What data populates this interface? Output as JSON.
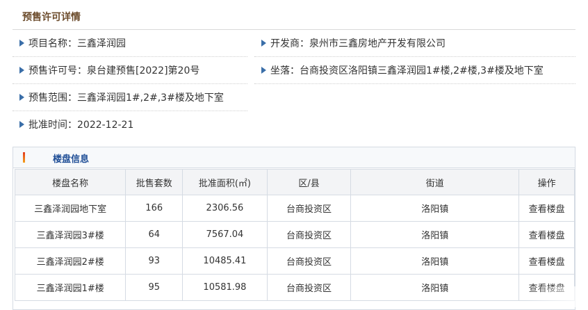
{
  "page": {
    "title": "预售许可详情"
  },
  "info": {
    "project_name": "项目名称：三鑫泽润园",
    "developer": "开发商：泉州市三鑫房地产开发有限公司",
    "license_no": "预售许可号：泉台建预售[2022]第20号",
    "location": "坐落：台商投资区洛阳镇三鑫泽润园1#楼,2#楼,3#楼及地下室",
    "scope": "预售范围：三鑫泽润园1#,2#,3#楼及地下室",
    "approval_date": "批准时间：2022-12-21"
  },
  "buildings": {
    "title": "楼盘信息",
    "columns": [
      "楼盘名称",
      "批售套数",
      "批准面积(㎡)",
      "区/县",
      "街道",
      "操作"
    ],
    "rows": [
      [
        "三鑫泽润园地下室",
        "166",
        "2306.56",
        "台商投资区",
        "洛阳镇",
        "查看楼盘"
      ],
      [
        "三鑫泽润园3#楼",
        "64",
        "7567.04",
        "台商投资区",
        "洛阳镇",
        "查看楼盘"
      ],
      [
        "三鑫泽润园2#楼",
        "93",
        "10485.41",
        "台商投资区",
        "洛阳镇",
        "查看楼盘"
      ],
      [
        "三鑫泽润园1#楼",
        "95",
        "10581.98",
        "台商投资区",
        "洛阳镇",
        "查看楼盘"
      ]
    ]
  },
  "colors": {
    "accent": "#1f4e96",
    "title": "#6b4b2b",
    "bullet": "#3a6ea8"
  }
}
